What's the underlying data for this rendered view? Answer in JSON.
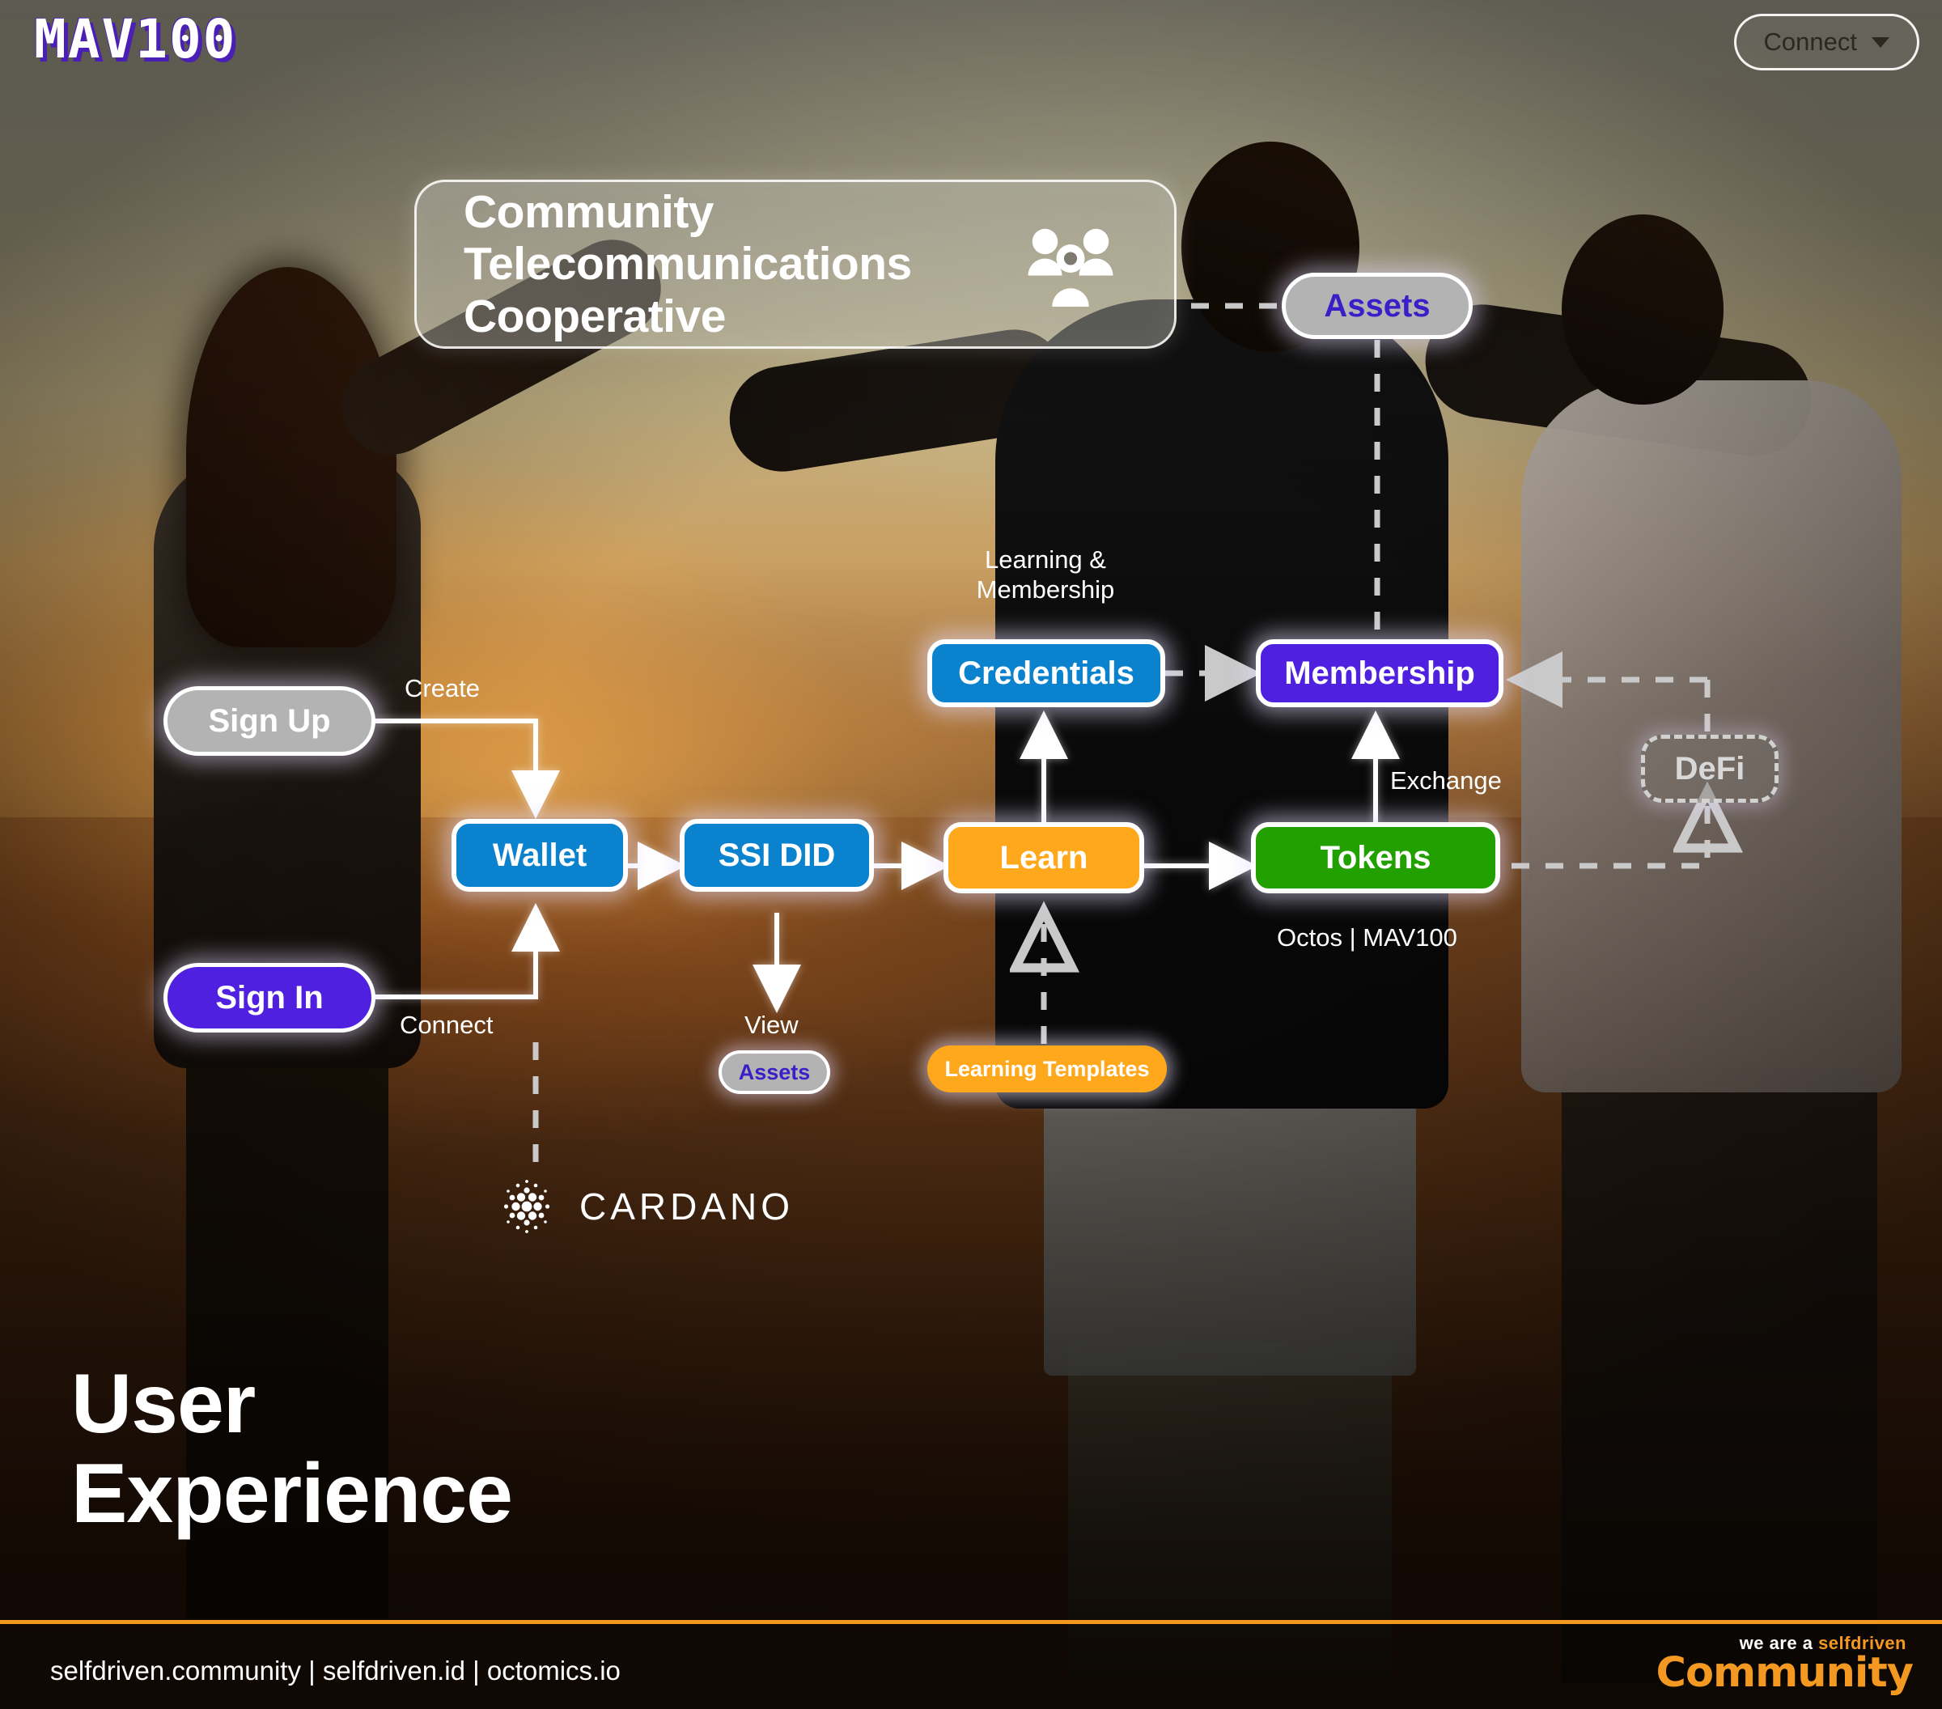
{
  "brand": {
    "logo": "MAV100"
  },
  "header": {
    "connect_label": "Connect",
    "caret_icon": "chevron-down-icon"
  },
  "title_card": {
    "title": "Community\nTelecommunications\nCooperative",
    "icon": "people-group-icon"
  },
  "nodes": {
    "assets_top": {
      "label": "Assets"
    },
    "credentials": {
      "label": "Credentials"
    },
    "membership": {
      "label": "Membership"
    },
    "defi": {
      "label": "DeFi"
    },
    "sign_up": {
      "label": "Sign Up"
    },
    "sign_in": {
      "label": "Sign In"
    },
    "wallet": {
      "label": "Wallet"
    },
    "ssi_did": {
      "label": "SSI DID"
    },
    "learn": {
      "label": "Learn"
    },
    "tokens": {
      "label": "Tokens"
    },
    "assets_small": {
      "label": "Assets"
    },
    "learning_templates": {
      "label": "Learning Templates"
    }
  },
  "edge_labels": {
    "create": "Create",
    "connect": "Connect",
    "view": "View",
    "learning_membership": "Learning &\nMembership",
    "exchange": "Exchange",
    "tokens_caption": "Octos | MAV100"
  },
  "chain": {
    "name": "CARDANO",
    "icon": "cardano-logo-icon"
  },
  "hero": {
    "text": "User\nExperience"
  },
  "footer": {
    "links": "selfdriven.community | selfdriven.id | octomics.io",
    "logo_top_white": "we are a ",
    "logo_top_orange": "selfdriven",
    "logo_main": "Community"
  },
  "colors": {
    "blue": "#0b82ce",
    "purple": "#4f20e0",
    "orange": "#ffa81c",
    "green": "#22a000",
    "gray": "#b3b3b3",
    "accent_orange": "#f39821",
    "assets_text": "#3a1fc8"
  }
}
